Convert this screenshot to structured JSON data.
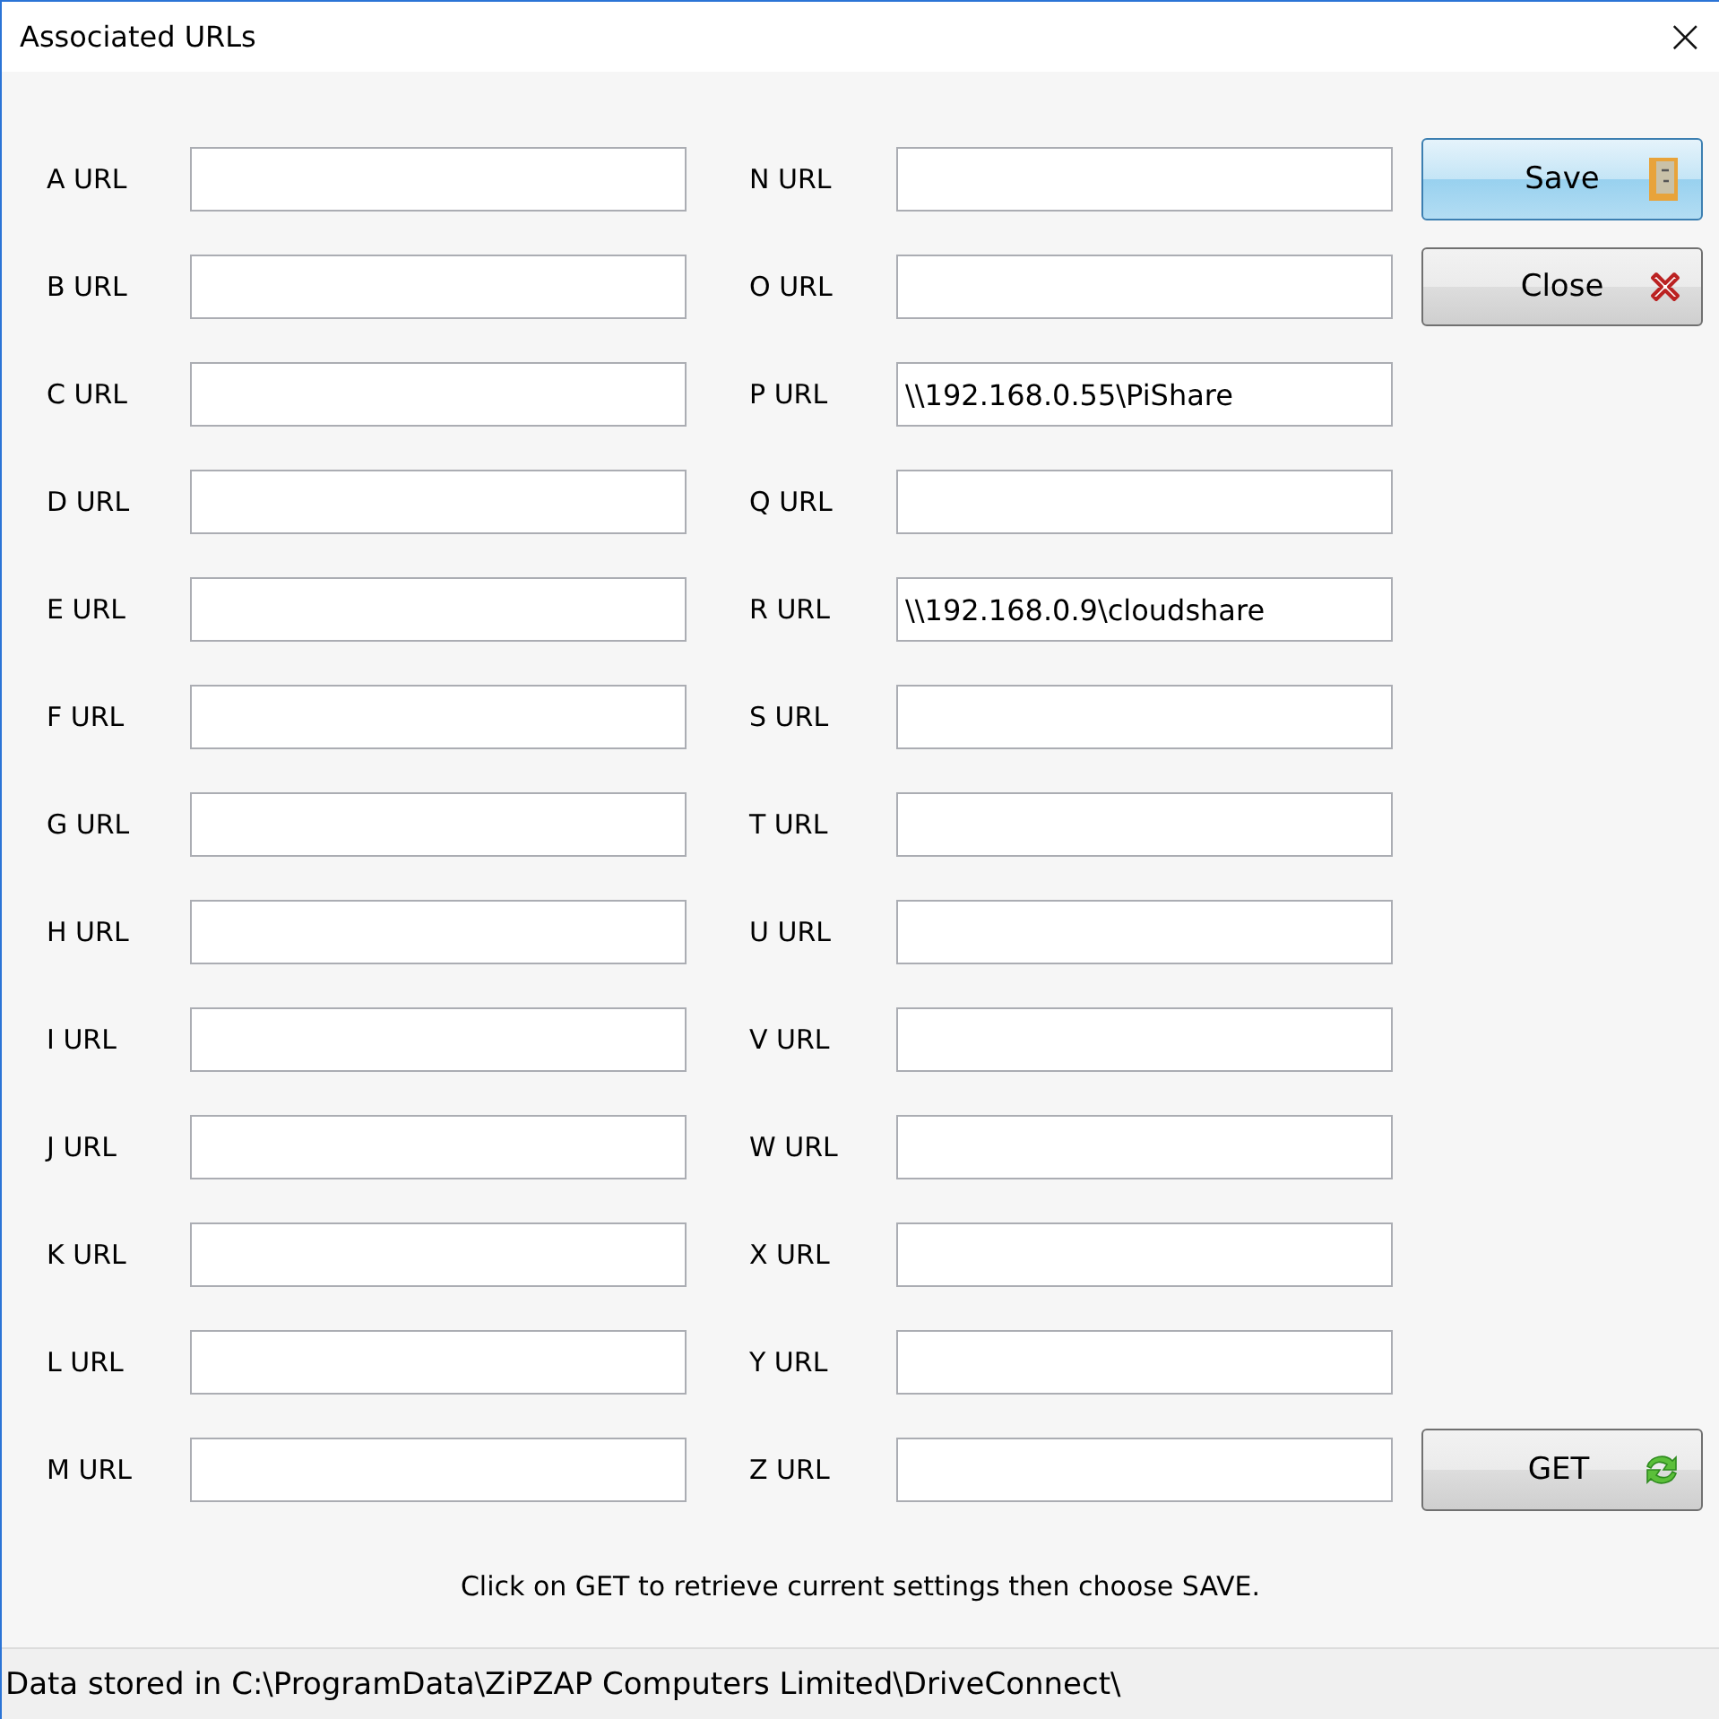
{
  "window": {
    "title": "Associated URLs",
    "close_glyph": "×"
  },
  "left_fields": [
    {
      "label": "A URL"
    },
    {
      "label": "B URL"
    },
    {
      "label": "C URL"
    },
    {
      "label": "D URL"
    },
    {
      "label": "E URL"
    },
    {
      "label": "F URL"
    },
    {
      "label": "G URL"
    },
    {
      "label": "H URL"
    },
    {
      "label": "I URL"
    },
    {
      "label": "J URL"
    },
    {
      "label": "K URL"
    },
    {
      "label": "L URL"
    },
    {
      "label": "M URL"
    }
  ],
  "right_fields": [
    {
      "label": "N URL"
    },
    {
      "label": "O URL"
    },
    {
      "label": "P URL",
      "value": "\\\\192.168.0.55\\PiShare"
    },
    {
      "label": "Q URL"
    },
    {
      "label": "R URL",
      "value": "\\\\192.168.0.9\\cloudshare"
    },
    {
      "label": "S URL"
    },
    {
      "label": "T URL"
    },
    {
      "label": "U URL"
    },
    {
      "label": "V URL"
    },
    {
      "label": "W URL"
    },
    {
      "label": "X URL"
    },
    {
      "label": "Y URL"
    },
    {
      "label": "Z URL"
    }
  ],
  "buttons": [
    {
      "label": "Save",
      "kind": "save"
    },
    {
      "label": "Close",
      "kind": "close"
    },
    {
      "label": "GET",
      "kind": "get"
    }
  ],
  "hint": "Click on GET to retrieve current settings then choose SAVE.",
  "status_bar": "Data stored in C:\\ProgramData\\ZiPZAP Computers Limited\\DriveConnect\\"
}
